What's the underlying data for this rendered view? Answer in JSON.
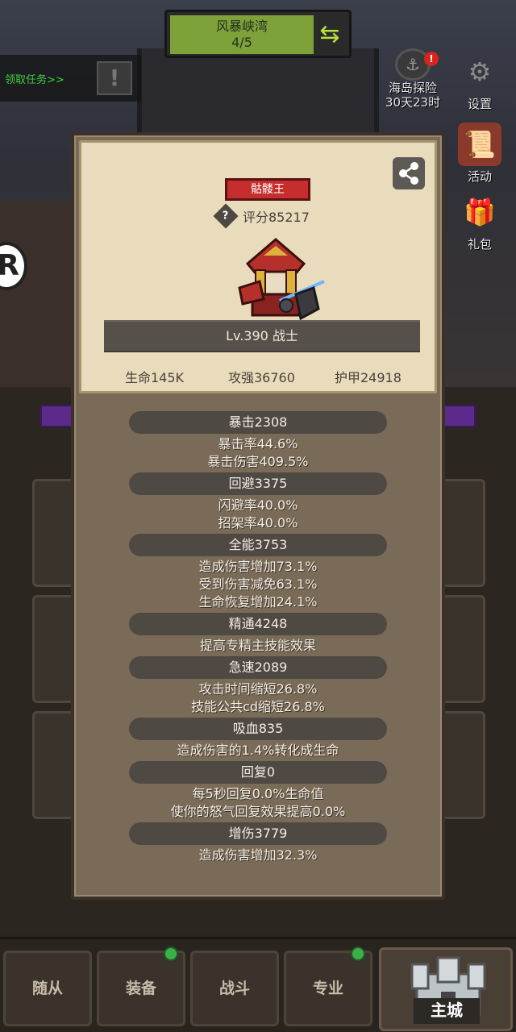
{
  "hud": {
    "stage_title": "风暴峡湾",
    "stage_progress": "4/5",
    "quest_link": "领取任务>>",
    "island_label": "海岛探险",
    "island_timer": "30天23时",
    "island_badge": "!",
    "settings_label": "设置",
    "activity_label": "活动",
    "gift_label": "礼包",
    "side_badge": "R"
  },
  "card": {
    "name": "骷髅王",
    "help_icon": "?",
    "score": "评分85217",
    "level": "Lv.390 战士",
    "attributes": {
      "hp": "生命145K",
      "attack": "攻强36760",
      "armor": "护甲24918"
    }
  },
  "stats": [
    {
      "title": "暴击2308",
      "lines": [
        "暴击率44.6%",
        "暴击伤害409.5%"
      ]
    },
    {
      "title": "回避3375",
      "lines": [
        "闪避率40.0%",
        "招架率40.0%"
      ]
    },
    {
      "title": "全能3753",
      "lines": [
        "造成伤害增加73.1%",
        "受到伤害减免63.1%",
        "生命恢复增加24.1%"
      ]
    },
    {
      "title": "精通4248",
      "lines": [
        "提高专精主技能效果"
      ]
    },
    {
      "title": "急速2089",
      "lines": [
        "攻击时间缩短26.8%",
        "技能公共cd缩短26.8%"
      ]
    },
    {
      "title": "吸血835",
      "lines": [
        "造成伤害的1.4%转化成生命"
      ]
    },
    {
      "title": "回复0",
      "lines": [
        "每5秒回复0.0%生命值",
        "使你的怒气回复效果提高0.0%"
      ]
    },
    {
      "title": "增伤3779",
      "lines": [
        "造成伤害增加32.3%"
      ]
    }
  ],
  "nav": {
    "followers": "随从",
    "equipment": "装备",
    "battle": "战斗",
    "profession": "专业",
    "main_city": "主城"
  },
  "colors": {
    "panel": "#7a6b58",
    "card": "#e9dcbc",
    "name_plate": "#c62d2d",
    "stat_pill": "#4f4943",
    "nav_badge": "#3bb04a",
    "quest_text": "#3fcf3f"
  }
}
